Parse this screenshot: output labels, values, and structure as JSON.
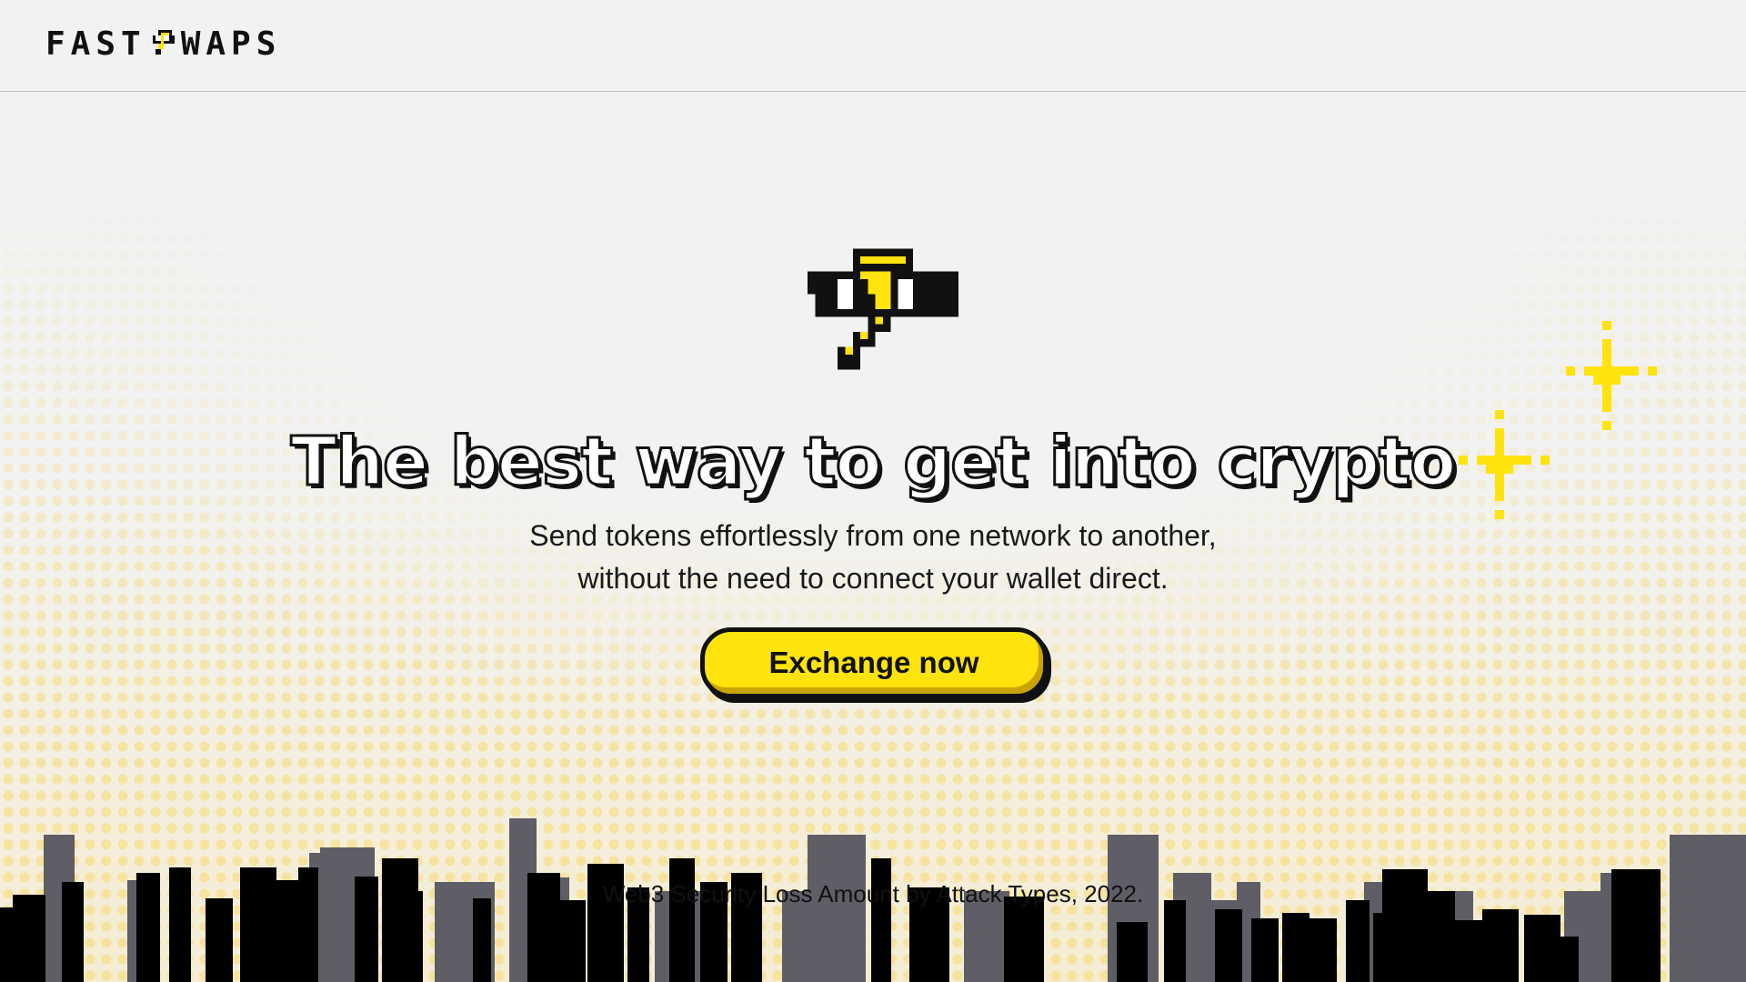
{
  "header": {
    "logo_alt": "FASTSWAPS",
    "logo_left": "FAST",
    "logo_right": "WAPS"
  },
  "hero": {
    "headline": "The best way to get into crypto",
    "subtitle_line1": "Send tokens effortlessly from one network to another,",
    "subtitle_line2": "without the need to connect your wallet direct.",
    "cta_label": "Exchange now"
  },
  "footer": {
    "caption": "Web3 Security Loss Amount by Attack Types, 2022."
  },
  "colors": {
    "brand_yellow": "#ffe30c",
    "ink": "#111111",
    "background": "#f2f2f2",
    "skyline_gray": "#5f5d66"
  },
  "icons": [
    "lightning-mascot-icon",
    "sparkle-icon"
  ]
}
